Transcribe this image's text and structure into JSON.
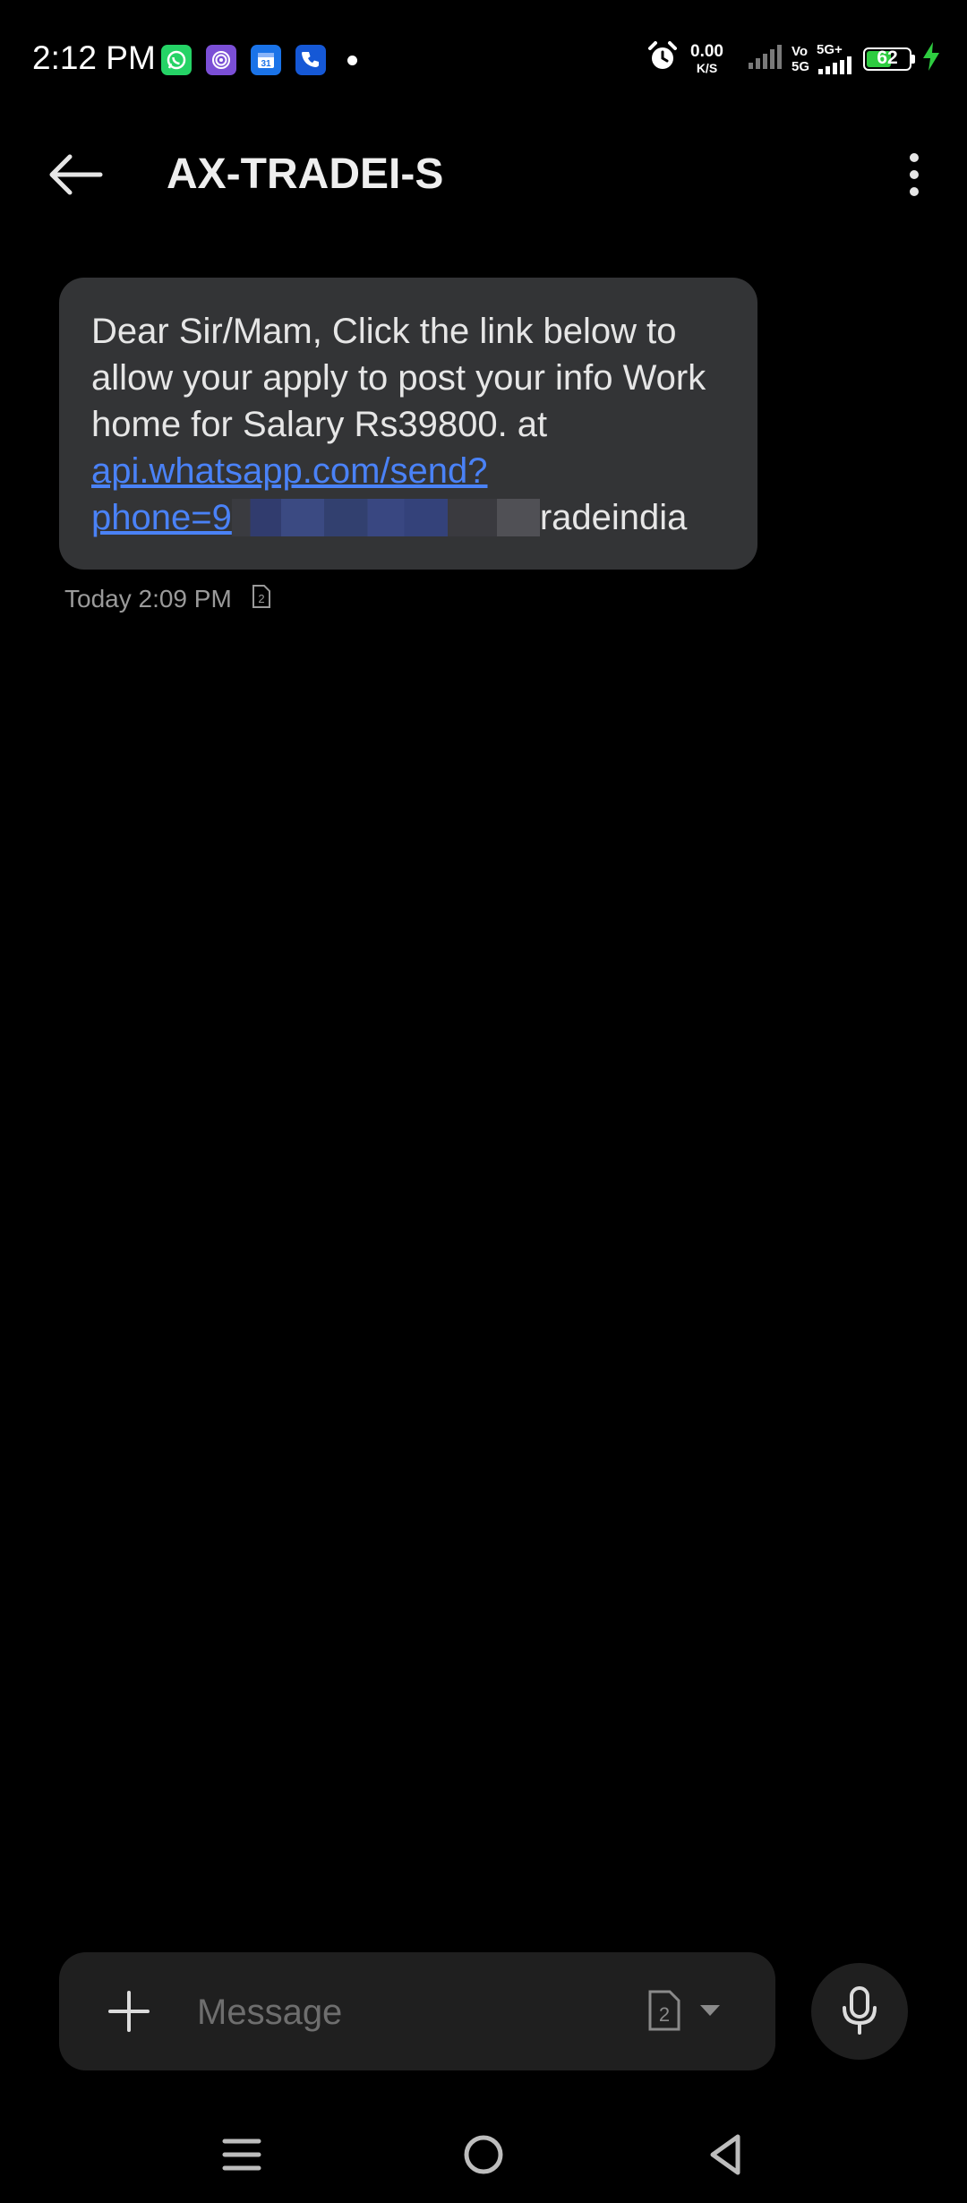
{
  "status_bar": {
    "time": "2:12 PM",
    "net_speed_value": "0.00",
    "net_speed_unit": "K/S",
    "vo_label": "Vo",
    "vo_5g_label": "5G",
    "signal_5g_label": "5G+",
    "battery_level": "62",
    "battery_fraction": 0.62,
    "notification_icons": [
      "whatsapp-icon",
      "fingerprint-icon",
      "calendar-icon",
      "phone-call-icon"
    ],
    "colors": {
      "whatsapp": "#25d366",
      "fingerprint": "#7b4fd6",
      "calendar": "#1a73e8",
      "phone": "#1558d6",
      "battery_fill": "#2ecc40"
    }
  },
  "header": {
    "title": "AX-TRADEI-S"
  },
  "message": {
    "text": "Dear Sir/Mam, Click the link below to allow your apply to post your info Work home for Salary Rs39800. at",
    "link_line1": "api.whatsapp.com/send?",
    "link_line2_prefix": "phone=9",
    "text_after_link": "radeindia",
    "timestamp": "Today 2:09 PM",
    "sim_number": "2"
  },
  "composer": {
    "placeholder": "Message",
    "sim_number": "2"
  },
  "colors": {
    "background": "#000000",
    "bubble": "#333436",
    "link": "#4a82f7",
    "composer": "#1f1f1f"
  }
}
